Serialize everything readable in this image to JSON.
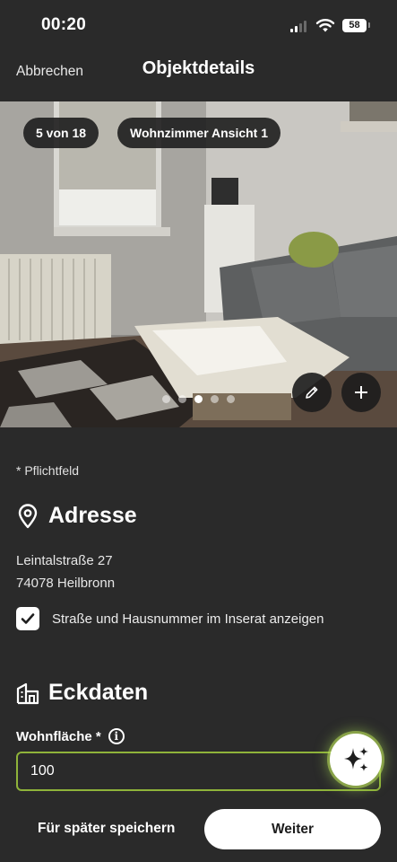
{
  "status_bar": {
    "time": "00:20",
    "battery": "58"
  },
  "nav": {
    "cancel_label": "Abbrechen",
    "title": "Objektdetails"
  },
  "photo": {
    "counter": "5 von 18",
    "caption": "Wohnzimmer Ansicht 1",
    "dots_total": 5,
    "dots_active_index": 2,
    "edit_icon": "pencil-icon",
    "add_icon": "plus-icon"
  },
  "form": {
    "required_note": "* Pflichtfeld",
    "address": {
      "heading": "Adresse",
      "icon": "location-pin-icon",
      "street": "Leintalstraße 27",
      "city": "74078 Heilbronn",
      "show_address_label": "Straße und Hausnummer im Inserat anzeigen",
      "show_address_checked": true
    },
    "key_data": {
      "heading": "Eckdaten",
      "icon": "building-icon",
      "living_area_label": "Wohnfläche *",
      "living_area_value": "100"
    }
  },
  "actions": {
    "save_later_label": "Für später speichern",
    "next_label": "Weiter"
  },
  "colors": {
    "background": "#2a2a2a",
    "input_border": "#8fb33a",
    "button_bg": "#ffffff"
  }
}
